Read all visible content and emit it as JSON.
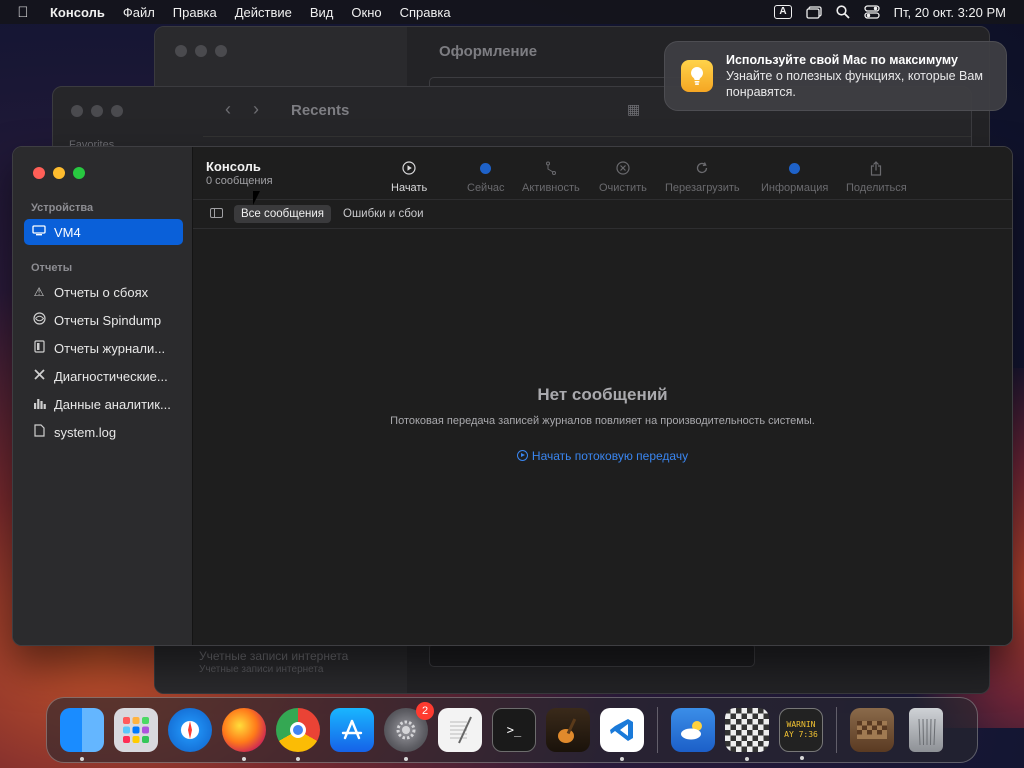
{
  "menubar": {
    "apple_icon": "apple-logo-icon",
    "app_name": "Консоль",
    "menus": [
      "Файл",
      "Правка",
      "Действие",
      "Вид",
      "Окно",
      "Справка"
    ],
    "input_source": "A",
    "datetime": "Пт, 20 окт.  3:20 PM"
  },
  "bg_settings_window": {
    "title": "Оформление",
    "accounts_label": "Учетные записи интернета",
    "accounts_sub": "Учетные записи интернета"
  },
  "bg_finder_window": {
    "title": "Recents",
    "favorites_label": "Favorites"
  },
  "notification": {
    "title": "Используйте свой Mac по максимуму",
    "body": "Узнайте о полезных функциях, которые Вам понравятся.",
    "icon": "lightbulb-icon"
  },
  "console": {
    "title": "Консоль",
    "subtitle": "0 сообщения",
    "sidebar": {
      "devices_header": "Устройства",
      "devices": [
        {
          "label": "VM4",
          "icon": "computer-icon",
          "selected": true
        }
      ],
      "reports_header": "Отчеты",
      "reports": [
        {
          "label": "Отчеты о сбоях",
          "icon": "warning-icon"
        },
        {
          "label": "Отчеты Spindump",
          "icon": "spindump-icon"
        },
        {
          "label": "Отчеты журнали...",
          "icon": "log-report-icon"
        },
        {
          "label": "Диагностические...",
          "icon": "tools-icon"
        },
        {
          "label": "Данные аналитик...",
          "icon": "chart-icon"
        },
        {
          "label": "system.log",
          "icon": "document-icon"
        }
      ]
    },
    "toolbar": {
      "start": "Начать",
      "now": "Сейчас",
      "activities": "Активность",
      "clear": "Очистить",
      "reload": "Перезагрузить",
      "info": "Информация",
      "share": "Поделиться"
    },
    "filters": {
      "all_messages": "Все сообщения",
      "errors_faults": "Ошибки и сбои"
    },
    "empty_state": {
      "title": "Нет сообщений",
      "subtitle": "Потоковая передача записей журналов повлияет на производительность системы.",
      "action": "Начать потоковую передачу"
    }
  },
  "dock": {
    "settings_badge": "2",
    "terminal_glyph": ">_",
    "console_icon_text_1": "WARNIN",
    "console_icon_text_2": "AY 7:36"
  }
}
